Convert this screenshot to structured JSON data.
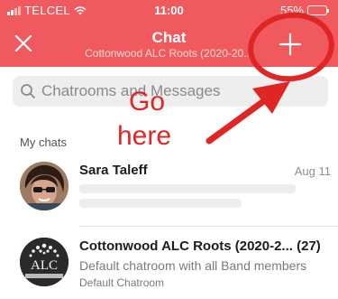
{
  "status_bar": {
    "carrier": "TELCEL",
    "time": "11:00",
    "battery": "55%",
    "battery_level": 0.55
  },
  "header": {
    "title": "Chat",
    "subtitle": "Cottonwood ALC Roots (2020-20..)"
  },
  "search": {
    "placeholder": "Chatrooms and Messages"
  },
  "section": {
    "my_chats": "My chats"
  },
  "chats": [
    {
      "name": "Sara Taleff",
      "date": "Aug 11"
    },
    {
      "name": "Cottonwood ALC Roots (2020-2... (27)",
      "description": "Default chatroom with all Band members",
      "type": "Default Chatroom",
      "avatar_text": "ALC"
    }
  ],
  "annotation": {
    "line1": "Go",
    "line2": "here"
  },
  "colors": {
    "brand": "#f05a5f",
    "annotation": "#e02525"
  },
  "icons": {
    "close": "close-icon",
    "add": "plus-icon",
    "search": "search-icon",
    "wifi": "wifi-icon",
    "battery": "battery-icon"
  }
}
